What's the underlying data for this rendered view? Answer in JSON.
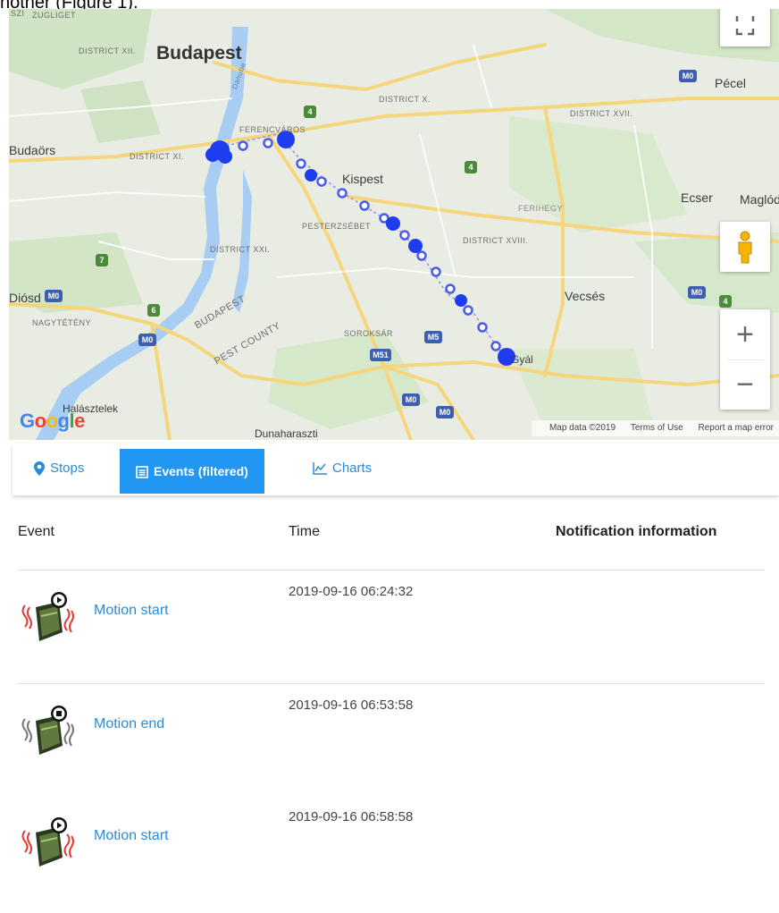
{
  "doc_fragment": "nother (Figure 1).",
  "map": {
    "labels": {
      "zugliget": "ZUGLIGET",
      "szi": "SZI",
      "district_xii": "DISTRICT XII.",
      "budapest": "Budapest",
      "duna": "Danube",
      "district_x": "DISTRICT X.",
      "pecel": "Pécel",
      "district_xvii": "DISTRICT XVII.",
      "budaors": "Budaörs",
      "district_xi": "DISTRICT XI.",
      "ferencvaros": "FERENCVÁROS",
      "kispest": "Kispest",
      "ecser": "Ecser",
      "maglod": "Maglód",
      "ferihegy": "FERIHEGY",
      "pesterzsebet": "PESTERZSÉBET",
      "district_xviii": "DISTRICT XVIII.",
      "district_xxi": "DISTRICT XXI.",
      "diosd": "Diósd",
      "nagyteteny": "NAGYTÉTÉNY",
      "budapest_county": "BUDAPEST",
      "pest_county": "PEST COUNTY",
      "soroksar": "SOROKSÁR",
      "vecses": "Vecsés",
      "gyal": "Gyál",
      "halasztelek": "Halásztelek",
      "dunaharaszti": "Dunaharaszti"
    },
    "shields": {
      "m0": "M0",
      "m5": "M5",
      "m51": "M51",
      "r4": "4",
      "r7": "7",
      "r6": "6"
    },
    "logo": "Google",
    "footer": {
      "map_data": "Map data ©2019",
      "terms": "Terms of Use",
      "report": "Report a map error"
    },
    "controls": {
      "zoom_in": "+",
      "zoom_out": "−"
    }
  },
  "tabs": {
    "stops": "Stops",
    "events": "Events (filtered)",
    "charts": "Charts"
  },
  "table": {
    "headers": {
      "event": "Event",
      "time": "Time",
      "notification": "Notification information"
    },
    "rows": [
      {
        "event": "Motion start",
        "time": "2019-09-16 06:24:32",
        "notification": ""
      },
      {
        "event": "Motion end",
        "time": "2019-09-16 06:53:58",
        "notification": ""
      },
      {
        "event": "Motion start",
        "time": "2019-09-16 06:58:58",
        "notification": ""
      }
    ]
  },
  "colors": {
    "tab_active": "#2196f3",
    "link": "#2a8bd8",
    "track_dot": "#1f3df0",
    "water": "#a7cdf2",
    "road": "#f6d77c"
  }
}
